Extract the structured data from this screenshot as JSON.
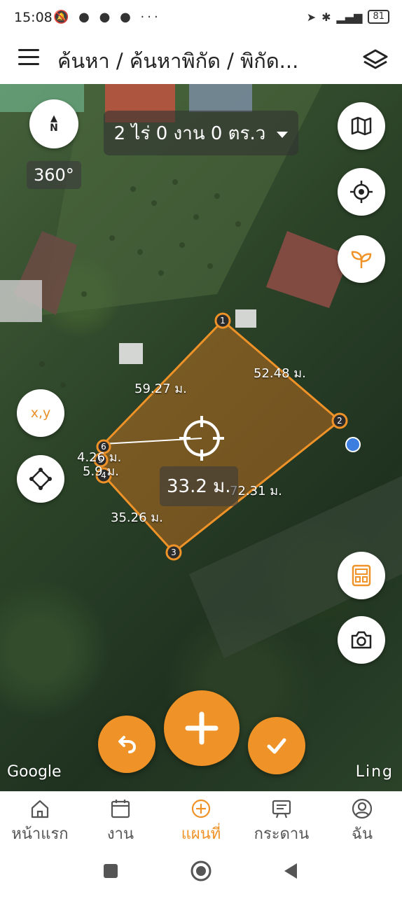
{
  "status_bar": {
    "time": "15:08",
    "left_icons": [
      "bell-off-icon",
      "chat-icon",
      "dot-icon",
      "dot-icon",
      "more-dots-icon"
    ],
    "more_glyph": "···",
    "battery": "81"
  },
  "app_bar": {
    "title": "ค้นหา / ค้นหาพิกัด / พิกัด..."
  },
  "map": {
    "rotation": "360°",
    "compass_label": "N",
    "area_summary": "2 ไร่ 0 งาน 0 ตร.ว",
    "segment_labels": {
      "s12": "52.48 ม.",
      "s61": "59.27 ม.",
      "s56": "4.26 ม.",
      "s45": "5.9 ม.",
      "s34": "35.26 ม.",
      "s23": "72.31 ม."
    },
    "center_distance": "33.2 ม.",
    "vertex_numbers": [
      "1",
      "2",
      "3",
      "4",
      "5",
      "6"
    ],
    "xy_button_label": "x,y",
    "google_label": "Google",
    "provider_label": "Ling"
  },
  "bottom_nav": {
    "items": [
      {
        "label": "หน้าแรก",
        "icon": "home-icon"
      },
      {
        "label": "งาน",
        "icon": "calendar-icon"
      },
      {
        "label": "แผนที่",
        "icon": "map-plus-icon"
      },
      {
        "label": "กระดาน",
        "icon": "board-icon"
      },
      {
        "label": "ฉัน",
        "icon": "profile-icon"
      }
    ],
    "active_index": 2
  },
  "colors": {
    "accent": "#ef9328",
    "polygon_fill": "rgba(214,120,30,0.45)"
  }
}
